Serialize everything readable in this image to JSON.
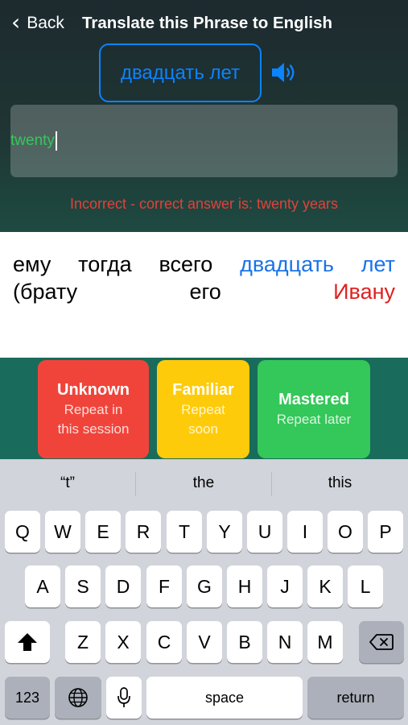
{
  "nav": {
    "back_label": "Back",
    "title": "Translate this Phrase to English"
  },
  "phrase": {
    "text": "двадцать лет",
    "speaker_icon": "speaker-icon"
  },
  "answer": {
    "value": "twenty"
  },
  "feedback": "Incorrect - correct answer is: twenty years",
  "sentence": {
    "line1": [
      "ему",
      "тогда",
      "всего",
      "двадцать",
      "лет"
    ],
    "line2": [
      "(брату",
      "его",
      "Ивану"
    ]
  },
  "rating": {
    "unknown": {
      "title": "Unknown",
      "subtitle": "Repeat in this session"
    },
    "familiar": {
      "title": "Familiar",
      "subtitle": "Repeat soon"
    },
    "mastered": {
      "title": "Mastered",
      "subtitle": "Repeat later"
    }
  },
  "colors": {
    "accent": "#0a84ff",
    "correct": "#34c759",
    "error": "#e2413a",
    "unknown": "#f0443a",
    "familiar": "#fecb0a",
    "mastered": "#34c759"
  },
  "keyboard": {
    "suggestions": [
      "“t”",
      "the",
      "this"
    ],
    "row1": [
      "Q",
      "W",
      "E",
      "R",
      "T",
      "Y",
      "U",
      "I",
      "O",
      "P"
    ],
    "row2": [
      "A",
      "S",
      "D",
      "F",
      "G",
      "H",
      "J",
      "K",
      "L"
    ],
    "row3": [
      "Z",
      "X",
      "C",
      "V",
      "B",
      "N",
      "M"
    ],
    "numbers_label": "123",
    "space_label": "space",
    "return_label": "return",
    "icons": [
      "shift-icon",
      "backspace-icon",
      "globe-icon",
      "microphone-icon"
    ]
  }
}
